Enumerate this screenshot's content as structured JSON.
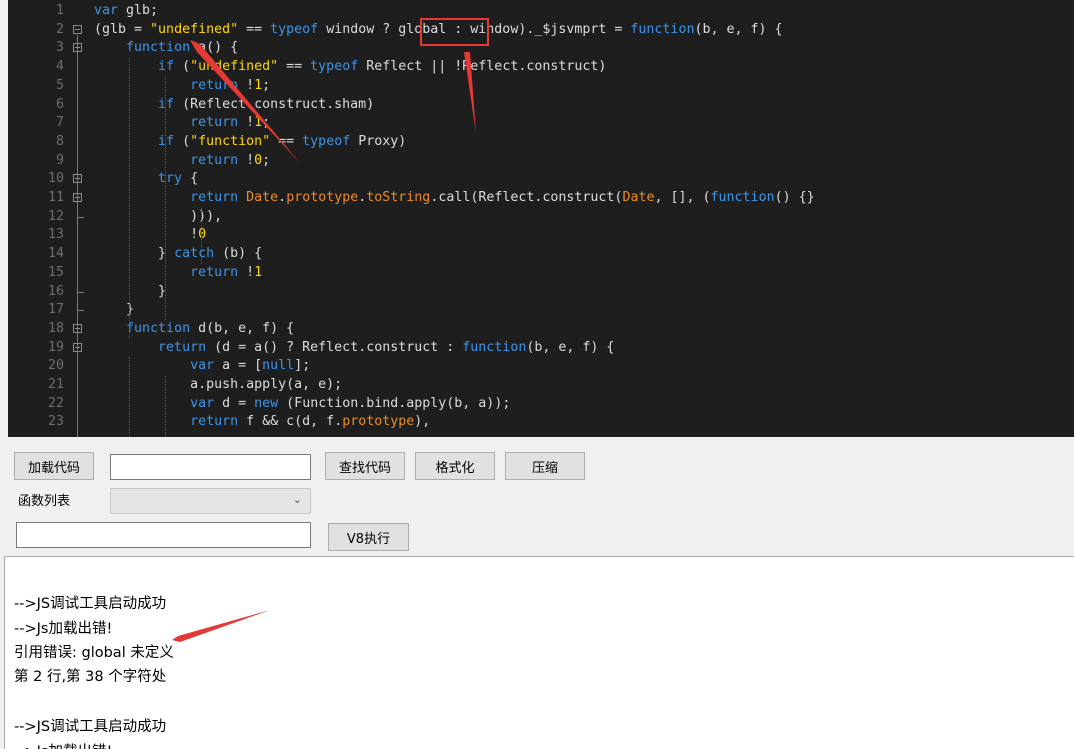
{
  "editor": {
    "lines": [
      {
        "n": "1",
        "html": "<span class=\"kw\">var</span> glb;"
      },
      {
        "n": "2",
        "html": "(glb = <span class=\"str\">\"undefined\"</span> == <span class=\"kw\">typeof</span> window ? global : window)._$jsvmprt = <span class=\"kw\">function</span>(b, e, f) {"
      },
      {
        "n": "3",
        "html": "    <span class=\"kw\">function</span> a() {"
      },
      {
        "n": "4",
        "html": "        <span class=\"kw\">if</span> (<span class=\"str\">\"undefined\"</span> == <span class=\"kw\">typeof</span> Reflect || !Reflect.construct)"
      },
      {
        "n": "5",
        "html": "            <span class=\"kw\">return</span> !<span class=\"num\">1</span>;"
      },
      {
        "n": "6",
        "html": "        <span class=\"kw\">if</span> (Reflect.construct.sham)"
      },
      {
        "n": "7",
        "html": "            <span class=\"kw\">return</span> !<span class=\"num\">1</span>;"
      },
      {
        "n": "8",
        "html": "        <span class=\"kw\">if</span> (<span class=\"str\">\"function\"</span> == <span class=\"kw\">typeof</span> Proxy)"
      },
      {
        "n": "9",
        "html": "            <span class=\"kw\">return</span> !<span class=\"num\">0</span>;"
      },
      {
        "n": "10",
        "html": "        <span class=\"kw\">try</span> {"
      },
      {
        "n": "11",
        "html": "            <span class=\"kw\">return</span> <span class=\"cls\">Date</span>.<span class=\"cls\">prototype</span>.<span class=\"cls\">toString</span>.call(Reflect.construct(<span class=\"cls\">Date</span>, [], (<span class=\"kw\">function</span>() {}"
      },
      {
        "n": "12",
        "html": "            ))),"
      },
      {
        "n": "13",
        "html": "            !<span class=\"num\">0</span>"
      },
      {
        "n": "14",
        "html": "        } <span class=\"kw\">catch</span> (b) {"
      },
      {
        "n": "15",
        "html": "            <span class=\"kw\">return</span> !<span class=\"num\">1</span>"
      },
      {
        "n": "16",
        "html": "        }"
      },
      {
        "n": "17",
        "html": "    }"
      },
      {
        "n": "18",
        "html": "    <span class=\"kw\">function</span> d(b, e, f) {"
      },
      {
        "n": "19",
        "html": "        <span class=\"kw\">return</span> (d = a() ? Reflect.construct : <span class=\"kw\">function</span>(b, e, f) {"
      },
      {
        "n": "20",
        "html": "            <span class=\"kw\">var</span> a = [<span class=\"kw\">null</span>];"
      },
      {
        "n": "21",
        "html": "            a.push.apply(a, e);"
      },
      {
        "n": "22",
        "html": "            <span class=\"kw\">var</span> d = <span class=\"kw\">new</span> (Function.bind.apply(b, a));"
      },
      {
        "n": "23",
        "html": "            <span class=\"kw\">return</span> f &amp;&amp; c(d, f.<span class=\"cls\">prototype</span>),"
      }
    ]
  },
  "toolbar": {
    "load_code": "加载代码",
    "find_code": "查找代码",
    "format": "格式化",
    "compress": "压缩",
    "function_list_label": "函数列表",
    "v8_exec": "V8执行"
  },
  "console": {
    "lines": [
      "-->JS调试工具启动成功",
      "-->Js加载出错!",
      "引用错误: global 未定义",
      "第 2 行,第 38 个字符处",
      "",
      "-->JS调试工具启动成功",
      "-->Js加载出错!"
    ]
  },
  "colors": {
    "editor_bg": "#1e1e1e",
    "keyword": "#3f94e8",
    "string": "#ffd700",
    "class": "#ea8c2b",
    "annotation": "#e53935"
  }
}
